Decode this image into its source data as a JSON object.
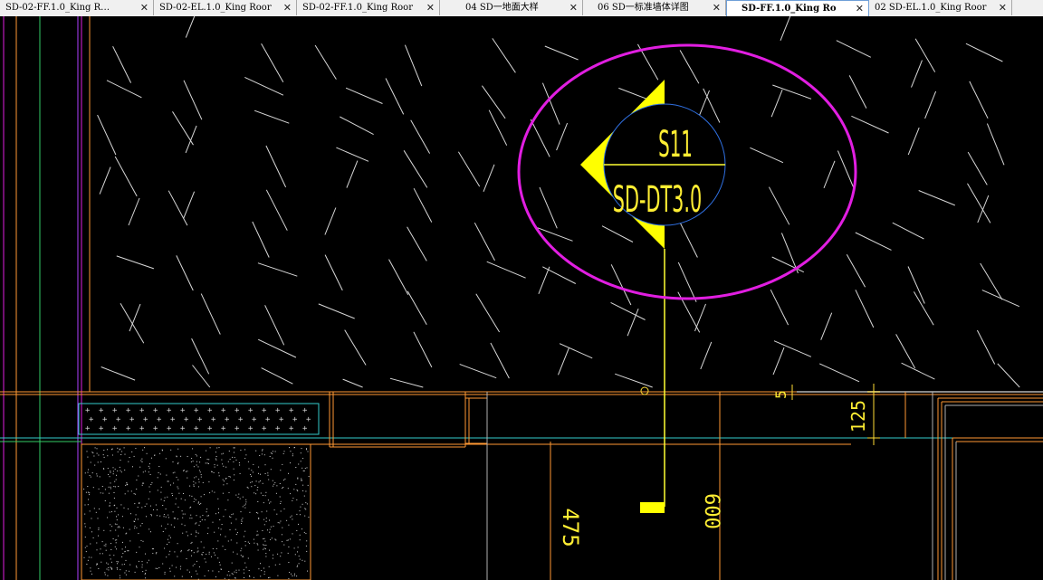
{
  "tabs": [
    {
      "label": "SD-02-FF.1.0_King R…",
      "active": false
    },
    {
      "label": "SD-02-EL.1.0_King Roor",
      "active": false
    },
    {
      "label": "SD-02-FF.1.0_King Roor",
      "active": false
    },
    {
      "label": "04 SD一地面大样",
      "active": false
    },
    {
      "label": "06 SD一标准墙体详图",
      "active": false
    },
    {
      "label": "SD-FF.1.0_King Ro",
      "active": true
    },
    {
      "label": "02 SD-EL.1.0_King Roor",
      "active": false
    }
  ],
  "tab_close_icon": "close-icon",
  "drawing": {
    "callout_number": "S11",
    "callout_sheet": "SD-DT3.0",
    "dimensions": {
      "dim_125": "125",
      "dim_5": "5",
      "dim_600": "600",
      "dim_475": "475"
    }
  },
  "colors": {
    "background": "#000000",
    "highlight_ellipse": "#e11ee1",
    "callout": "#ffff00",
    "callout_circle": "#2f6fe0",
    "wall_lines": "#ff9933",
    "cyan_lines": "#33cccc",
    "hatch": "#d8d8d8"
  }
}
